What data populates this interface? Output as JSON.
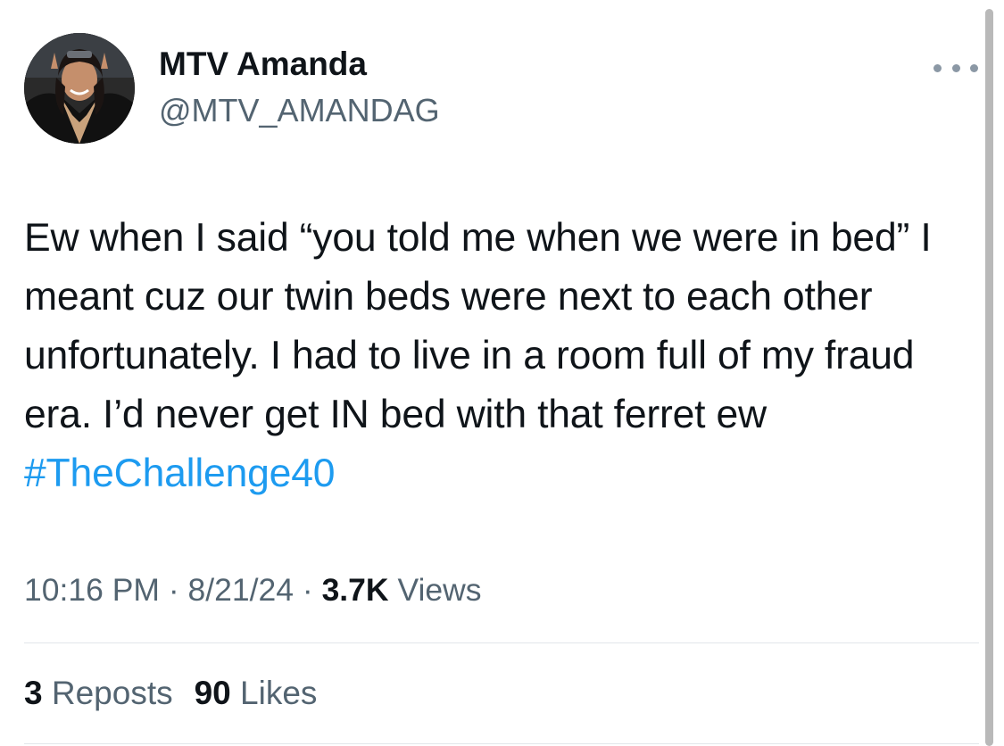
{
  "user": {
    "display_name": "MTV Amanda",
    "handle": "@MTV_AMANDAG",
    "avatar_icon": "profile-photo"
  },
  "more_icon": "ellipsis-icon",
  "tweet": {
    "text_before_hashtag": "Ew when I said “you told me when we were in bed” I meant cuz our twin beds were next to each other unfortunately. I had to live in a room full of my fraud era. I’d never get IN bed with that ferret ew ",
    "hashtag": "#TheChallenge40"
  },
  "meta": {
    "time": "10:16 PM",
    "separator": "·",
    "date": "8/21/24",
    "views_count": "3.7K",
    "views_label": "Views"
  },
  "engagement": {
    "reposts_count": "3",
    "reposts_label": "Reposts",
    "likes_count": "90",
    "likes_label": "Likes"
  },
  "colors": {
    "text": "#0f1419",
    "secondary": "#536471",
    "link": "#1d9bf0",
    "divider": "#e1e6ea"
  }
}
